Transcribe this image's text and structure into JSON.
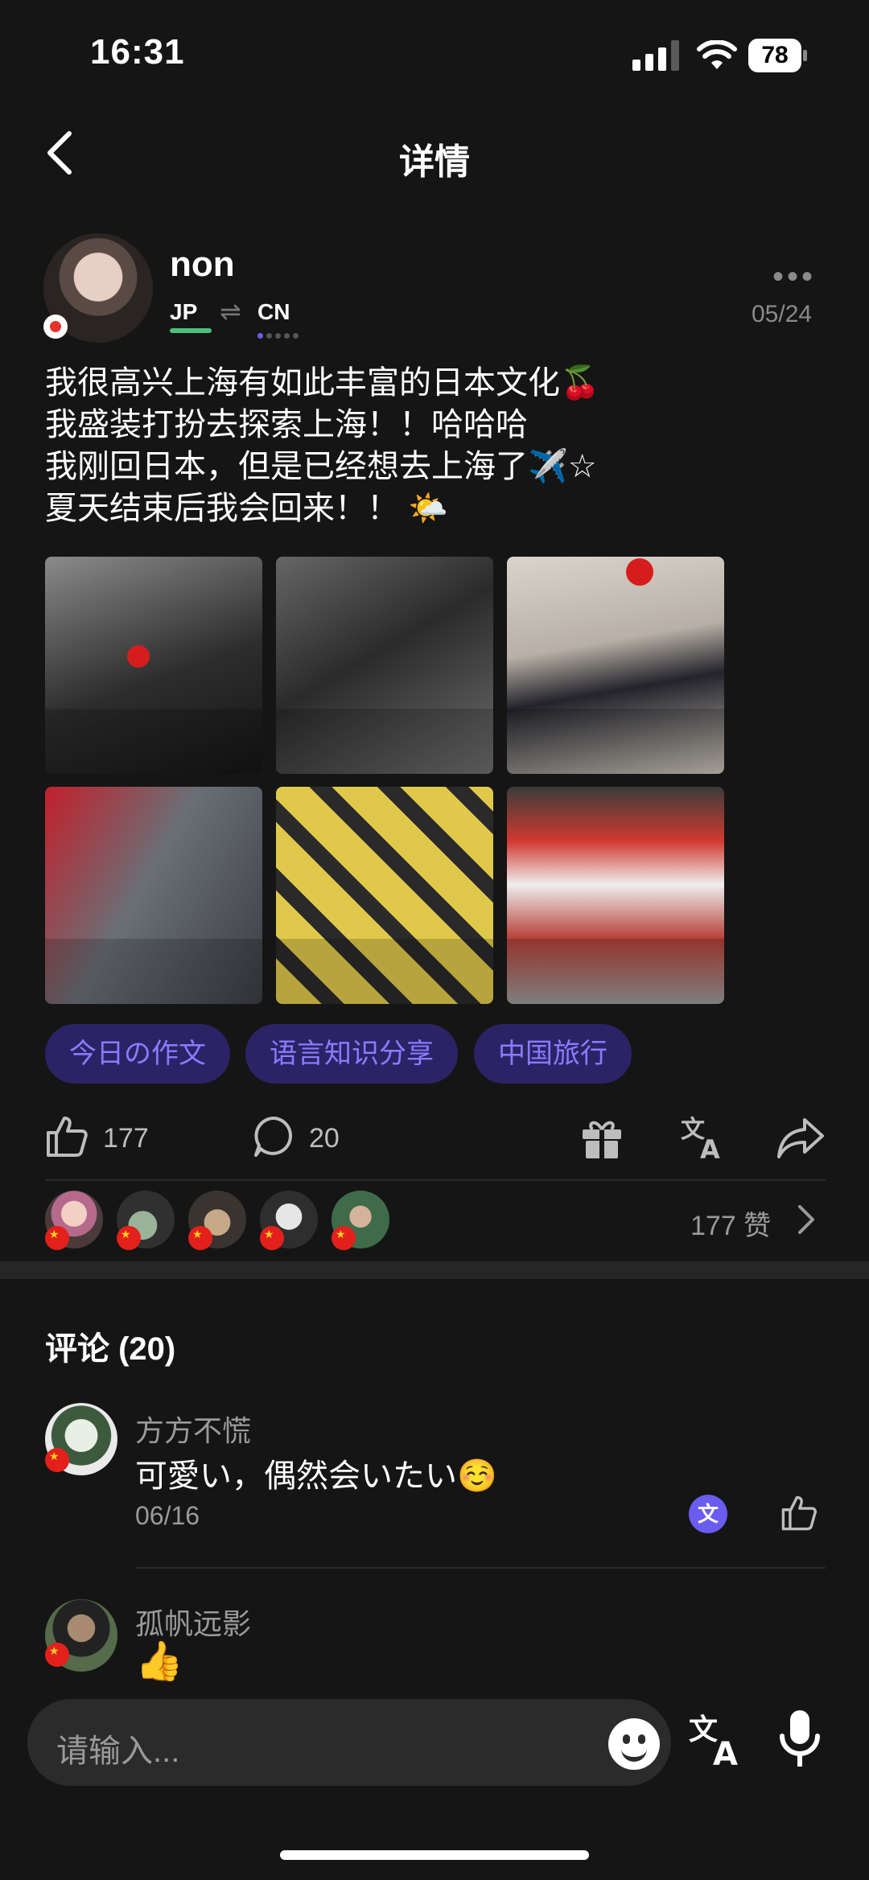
{
  "status_bar": {
    "time": "16:31",
    "battery": "78"
  },
  "header": {
    "title": "详情"
  },
  "post": {
    "username": "non",
    "lang_native": "JP",
    "lang_learning": "CN",
    "date": "05/24",
    "text_lines": [
      "我很高兴上海有如此丰富的日本文化🍒",
      "我盛装打扮去探索上海！！哈哈哈",
      "我刚回日本，但是已经想去上海了✈️☆",
      "夏天结束后我会回来！！ 🌤️"
    ],
    "photos": [
      "photo-1",
      "photo-2",
      "photo-3",
      "photo-4",
      "photo-5",
      "photo-6"
    ],
    "tags": [
      "今日の作文",
      "语言知识分享",
      "中国旅行"
    ],
    "likes": "177",
    "comments": "20",
    "likes_total": "177 赞"
  },
  "comments_section": {
    "title": "评论 (20)",
    "items": [
      {
        "name": "方方不慌",
        "text": "可愛い，偶然会いたい☺️",
        "date": "06/16"
      },
      {
        "name": "孤帆远影",
        "text": "👍"
      }
    ]
  },
  "bottom_bar": {
    "placeholder": "请输入..."
  },
  "colors": {
    "accent": "#6b5cf0",
    "tag_bg": "#2c2366",
    "tag_text": "#8a7bff",
    "native_lang": "#4cc07a"
  }
}
